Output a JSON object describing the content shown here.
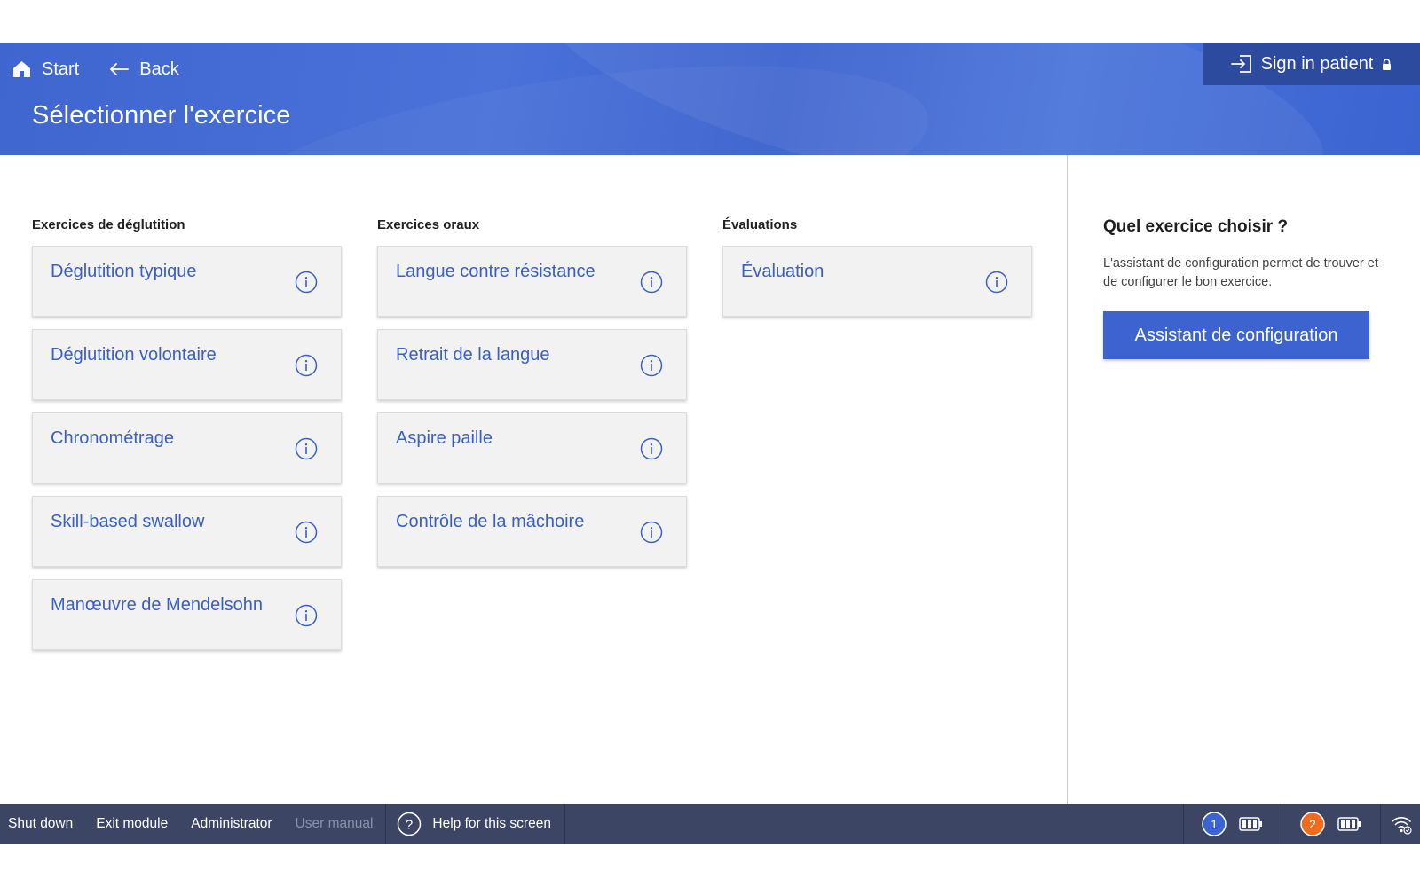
{
  "nav": {
    "start_label": "Start",
    "back_label": "Back",
    "signin_label": "Sign in patient"
  },
  "page": {
    "title": "Sélectionner l'exercice"
  },
  "columns": [
    {
      "title": "Exercices de déglutition",
      "items": [
        "Déglutition typique",
        "Déglutition volontaire",
        "Chronométrage",
        "Skill-based swallow",
        "Manœuvre de Mendelsohn"
      ]
    },
    {
      "title": "Exercices oraux",
      "items": [
        "Langue contre résistance",
        "Retrait de la langue",
        "Aspire paille",
        "Contrôle de la mâchoire"
      ]
    },
    {
      "title": "Évaluations",
      "items": [
        "Évaluation"
      ]
    }
  ],
  "side": {
    "title": "Quel exercice choisir ?",
    "text": "L'assistant de configuration permet de trouver et de configurer le bon exercice.",
    "button_label": "Assistant de configuration"
  },
  "footer": {
    "shutdown": "Shut down",
    "exit_module": "Exit module",
    "administrator": "Administrator",
    "user_manual": "User manual",
    "help": "Help for this screen",
    "device1_badge": "1",
    "device2_badge": "2"
  },
  "colors": {
    "header": "#4169d4",
    "accent": "#3d63d0",
    "card_text": "#3a5fc8",
    "footer": "#3d4565",
    "device1": "#3a63d3",
    "device2": "#f26b1d"
  }
}
